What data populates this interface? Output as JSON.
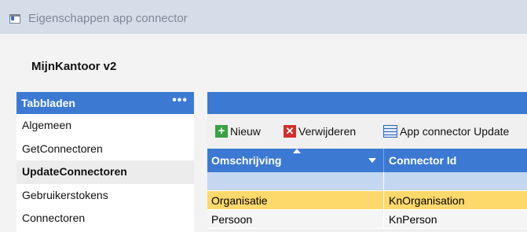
{
  "window": {
    "title": "Eigenschappen app connector"
  },
  "app_title": "MijnKantoor v2",
  "sidebar": {
    "header": "Tabbladen",
    "more": "•••",
    "items": [
      {
        "label": "Algemeen"
      },
      {
        "label": "GetConnectoren"
      },
      {
        "label": "UpdateConnectoren"
      },
      {
        "label": "Gebruikerstokens"
      },
      {
        "label": "Connectoren"
      }
    ],
    "active_index": 2
  },
  "toolbar": {
    "new_label": "Nieuw",
    "delete_label": "Verwijderen",
    "update_label": "App connector Update"
  },
  "grid": {
    "columns": [
      "Omschrijving",
      "Connector Id"
    ],
    "rows": [
      {
        "omschrijving": "Organisatie",
        "connector_id": "KnOrganisation",
        "selected": true
      },
      {
        "omschrijving": "Persoon",
        "connector_id": "KnPerson",
        "selected": false
      }
    ]
  },
  "colors": {
    "accent": "#3c79d3",
    "selection": "#fdd96b",
    "filter_row": "#c4d7f1"
  }
}
